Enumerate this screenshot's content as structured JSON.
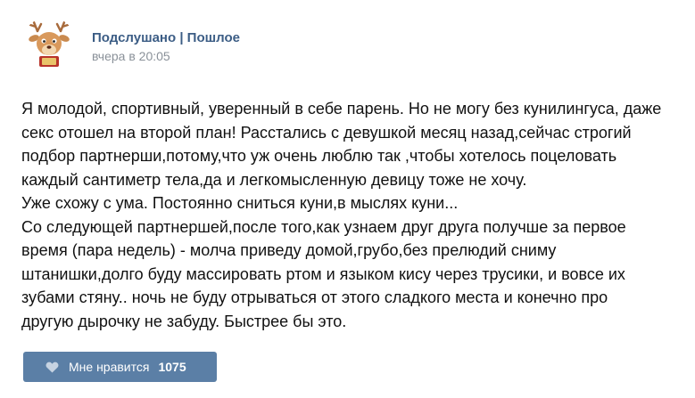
{
  "post": {
    "author_name": "Подслушано | Пошлое",
    "date": "вчера в 20:05",
    "avatar_icon": "deer-avatar-icon",
    "text_lines": [
      "Я молодой, спортивный, уверенный в себе парень. Но не могу без кунилингуса, даже",
      "секс отошел на второй план! Расстались с девушкой месяц назад,сейчас строгий",
      "подбор партнерши,потому,что уж очень люблю так ,чтобы хотелось поцеловать",
      "каждый сантиметр тела,да и легкомысленную девицу тоже не хочу.",
      "Уже схожу с ума. Постоянно сниться куни,в мыслях куни...",
      "Со следующей партнершей,после того,как узнаем друг друга получше за первое",
      "время (пара недель) - молча приведу домой,грубо,без прелюдий сниму",
      "штанишки,долго буду массировать ртом и языком кису через трусики, и вовсе их",
      "зубами стяну.. ночь не буду отрываться от этого сладкого места и конечно про",
      "другую дырочку не забуду. Быстрее бы это."
    ]
  },
  "like_button": {
    "icon": "heart-icon",
    "label": "Мне нравится",
    "count": "1075",
    "color": "#5b7fa6"
  },
  "colors": {
    "author_name": "#3c5d85",
    "date": "#8a9199",
    "text": "#111111"
  }
}
